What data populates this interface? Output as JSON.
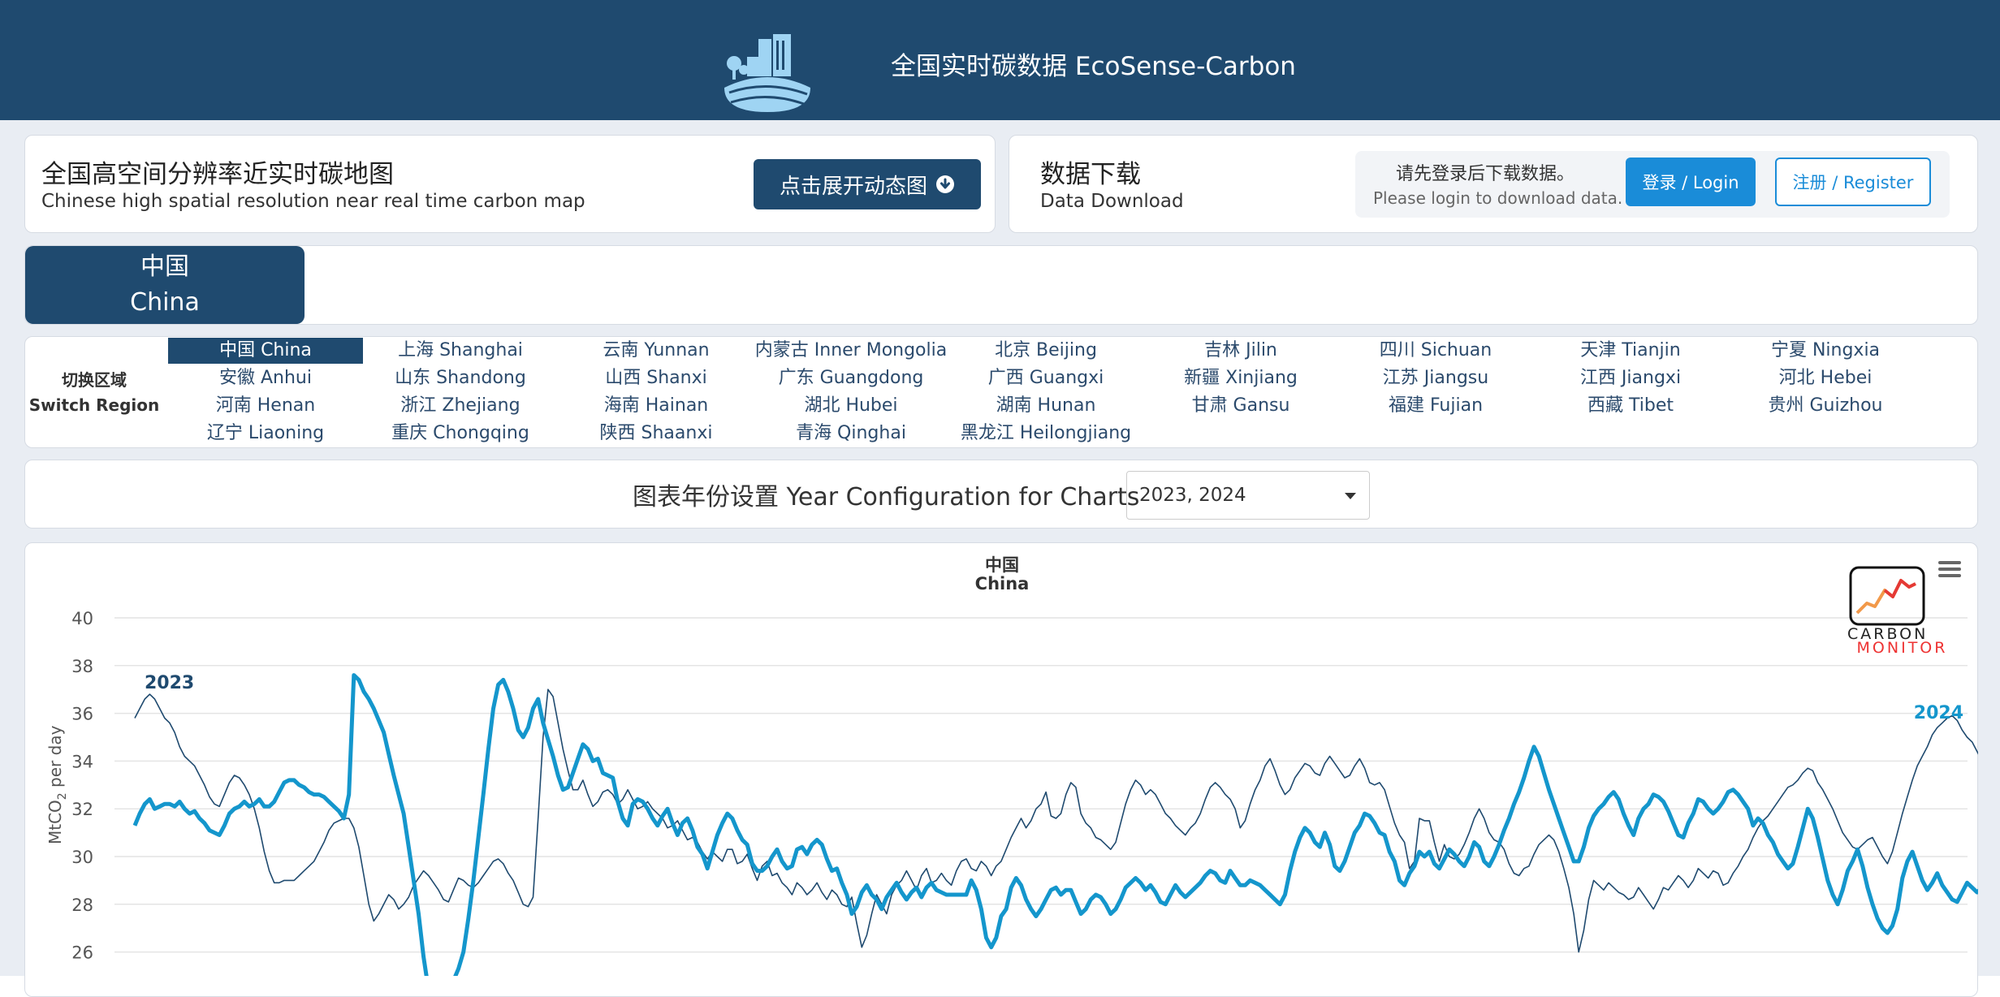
{
  "header": {
    "title": "全国实时碳数据 EcoSense-Carbon"
  },
  "map_card": {
    "title": "全国高空间分辨率近实时碳地图",
    "subtitle": "Chinese high spatial resolution near real time carbon map",
    "expand_button": "点击展开动态图"
  },
  "download_card": {
    "title": "数据下载",
    "subtitle": "Data Download",
    "login_message_cn": "请先登录后下载数据。",
    "login_message_en": "Please login to download data.",
    "login_button": "登录 / Login",
    "register_button": "注册 / Register"
  },
  "country_tab": {
    "cn": "中国",
    "en": "China"
  },
  "region_switcher": {
    "label_cn": "切换区域",
    "label_en": "Switch Region",
    "active": "中国 China",
    "regions": [
      "中国 China",
      "上海 Shanghai",
      "云南 Yunnan",
      "内蒙古 Inner Mongolia",
      "北京 Beijing",
      "吉林 Jilin",
      "四川 Sichuan",
      "天津 Tianjin",
      "宁夏 Ningxia",
      "安徽 Anhui",
      "山东 Shandong",
      "山西 Shanxi",
      "广东 Guangdong",
      "广西 Guangxi",
      "新疆 Xinjiang",
      "江苏 Jiangsu",
      "江西 Jiangxi",
      "河北 Hebei",
      "河南 Henan",
      "浙江 Zhejiang",
      "海南 Hainan",
      "湖北 Hubei",
      "湖南 Hunan",
      "甘肃 Gansu",
      "福建 Fujian",
      "西藏 Tibet",
      "贵州 Guizhou",
      "辽宁 Liaoning",
      "重庆 Chongqing",
      "陕西 Shaanxi",
      "青海 Qinghai",
      "黑龙江 Heilongjiang"
    ]
  },
  "year_config": {
    "label": "图表年份设置 Year Configuration for Charts",
    "selected": "2023, 2024"
  },
  "chart_logo": {
    "line1": "CARBON",
    "line2": "MONITOR"
  },
  "colors": {
    "header_bg": "#1f4a6f",
    "accent": "#1a8cd8",
    "series_2024": "#1496cc",
    "series_2023": "#1f4a6f"
  },
  "chart_data": {
    "type": "line",
    "title": "中国",
    "subtitle": "China",
    "ylabel": "MtCO2 per day",
    "ylim": [
      26,
      40
    ],
    "yticks": [
      26,
      28,
      30,
      32,
      34,
      36,
      38,
      40
    ],
    "grid": true,
    "x": "day of year 1-365",
    "series": [
      {
        "name": "2023",
        "values": [
          35.8,
          36.2,
          36.6,
          36.8,
          36.6,
          36.2,
          35.8,
          35.6,
          35.2,
          34.6,
          34.2,
          34.0,
          33.8,
          33.4,
          33.0,
          32.5,
          32.2,
          32.1,
          32.6,
          33.1,
          33.4,
          33.3,
          33.0,
          32.6,
          32.0,
          31.2,
          30.2,
          29.4,
          28.9,
          28.9,
          29.0,
          29.0,
          29.0,
          29.2,
          29.4,
          29.6,
          29.8,
          30.2,
          30.6,
          31.1,
          31.4,
          31.5,
          31.6,
          31.6,
          31.2,
          30.4,
          29.2,
          28.0,
          27.3,
          27.6,
          28.0,
          28.4,
          28.2,
          27.8,
          28.0,
          28.3,
          28.8,
          29.1,
          29.4,
          29.2,
          28.9,
          28.6,
          28.2,
          28.1,
          28.6,
          29.1,
          29.0,
          28.8,
          28.7,
          28.9,
          29.2,
          29.5,
          29.8,
          29.9,
          29.7,
          29.3,
          29.0,
          28.5,
          28.0,
          27.9,
          28.3,
          31.6,
          35.0,
          37.0,
          36.7,
          35.6,
          34.5,
          33.6,
          32.8,
          32.8,
          33.2,
          32.6,
          32.1,
          32.3,
          32.7,
          32.8,
          32.6,
          32.2,
          32.4,
          32.8,
          32.4,
          32.0,
          32.1,
          32.3,
          32.0,
          31.8,
          31.6,
          31.2,
          31.3,
          31.5,
          31.1,
          30.7,
          30.8,
          30.6,
          30.2,
          29.9,
          30.2,
          30.0,
          29.8,
          30.3,
          30.3,
          29.7,
          29.8,
          30.1,
          29.5,
          29.0,
          29.6,
          29.8,
          29.2,
          29.3,
          28.9,
          28.7,
          28.4,
          28.9,
          28.7,
          28.4,
          28.6,
          28.9,
          28.5,
          28.2,
          28.6,
          28.4,
          28.0,
          27.9,
          28.3,
          27.2,
          26.2,
          26.7,
          27.6,
          28.4,
          28.0,
          27.6,
          28.4,
          28.8,
          29.0,
          29.4,
          29.0,
          28.6,
          29.2,
          29.5,
          28.9,
          29.0,
          29.3,
          29.0,
          28.8,
          29.4,
          29.8,
          29.9,
          29.5,
          29.4,
          29.8,
          29.6,
          29.2,
          29.6,
          29.8,
          30.3,
          30.8,
          31.2,
          31.6,
          31.2,
          31.5,
          32.0,
          32.2,
          32.7,
          31.7,
          31.6,
          31.8,
          32.6,
          33.1,
          32.9,
          31.8,
          31.4,
          31.2,
          30.8,
          30.7,
          30.5,
          30.3,
          30.6,
          31.4,
          32.2,
          32.8,
          33.2,
          33.0,
          32.6,
          32.8,
          32.6,
          32.2,
          31.8,
          31.6,
          31.3,
          31.1,
          30.9,
          31.2,
          31.4,
          31.8,
          32.4,
          32.9,
          33.1,
          32.9,
          32.6,
          32.4,
          32.0,
          31.2,
          31.5,
          32.2,
          32.8,
          33.2,
          33.8,
          34.1,
          33.6,
          33.0,
          32.6,
          32.8,
          33.3,
          33.6,
          33.9,
          33.8,
          33.5,
          33.4,
          33.9,
          34.2,
          33.9,
          33.6,
          33.3,
          33.4,
          33.8,
          34.1,
          33.7,
          33.1,
          33.0,
          33.1,
          32.8,
          32.1,
          31.4,
          30.9,
          30.6,
          29.5,
          29.8,
          31.6,
          31.5,
          31.5,
          30.6,
          29.8,
          30.5,
          30.0,
          29.9,
          30.1,
          30.5,
          31.0,
          31.6,
          32.0,
          31.6,
          31.0,
          30.7,
          30.6,
          30.3,
          29.7,
          29.3,
          29.2,
          29.5,
          29.6,
          30.1,
          30.5,
          30.7,
          30.9,
          30.7,
          30.2,
          29.5,
          28.7,
          27.6,
          26.0,
          26.9,
          28.2,
          29.0,
          28.8,
          28.6,
          28.9,
          28.7,
          28.5,
          28.4,
          28.2,
          28.3,
          28.7,
          28.4,
          28.1,
          27.8,
          28.2,
          28.7,
          28.6,
          28.9,
          29.2,
          29.0,
          28.7,
          29.0,
          29.5,
          29.3,
          29.1,
          29.4,
          29.3,
          28.8,
          28.9,
          29.3,
          29.6,
          30.0,
          30.3,
          30.8,
          31.2,
          31.5,
          31.7,
          32.0,
          32.3,
          32.6,
          32.9,
          33.0,
          33.2,
          33.5,
          33.7,
          33.6,
          33.1,
          32.8,
          32.4,
          32.0,
          31.5,
          31.0,
          30.7,
          30.4,
          30.3,
          30.5,
          30.7,
          30.8,
          30.4,
          30.0,
          29.7,
          30.2,
          31.0,
          31.8,
          32.5,
          33.2,
          33.8,
          34.2,
          34.6,
          35.1,
          35.4,
          35.6,
          35.8,
          35.9,
          35.7,
          35.3,
          35.0,
          34.8,
          34.4,
          34.0,
          33.7,
          33.4
        ]
      },
      {
        "name": "2024",
        "values": [
          31.3,
          31.8,
          32.2,
          32.4,
          32.0,
          32.1,
          32.2,
          32.2,
          32.1,
          32.3,
          32.0,
          31.8,
          31.9,
          31.6,
          31.4,
          31.1,
          31.0,
          30.9,
          31.3,
          31.8,
          32.0,
          32.1,
          32.3,
          32.1,
          32.2,
          32.4,
          32.1,
          32.1,
          32.3,
          32.7,
          33.1,
          33.2,
          33.2,
          33.0,
          32.9,
          32.7,
          32.6,
          32.6,
          32.5,
          32.3,
          32.1,
          31.9,
          31.6,
          32.6,
          37.6,
          37.4,
          36.9,
          36.6,
          36.2,
          35.7,
          35.2,
          34.3,
          33.4,
          32.6,
          31.8,
          30.4,
          29.0,
          27.6,
          25.8,
          24.4,
          23.6,
          23.8,
          24.2,
          24.6,
          24.8,
          25.3,
          26.0,
          27.4,
          29.0,
          30.8,
          32.6,
          34.5,
          36.2,
          37.2,
          37.4,
          36.9,
          36.2,
          35.3,
          35.0,
          35.4,
          36.2,
          36.6,
          35.6,
          34.9,
          34.2,
          33.4,
          32.8,
          32.9,
          33.5,
          34.1,
          34.7,
          34.5,
          34.0,
          34.1,
          33.5,
          33.4,
          33.3,
          32.3,
          31.6,
          31.3,
          32.2,
          32.4,
          32.3,
          32.0,
          31.6,
          31.3,
          31.7,
          32.0,
          31.4,
          30.9,
          31.4,
          31.6,
          31.1,
          30.4,
          30.1,
          29.5,
          30.2,
          30.9,
          31.4,
          31.8,
          31.6,
          31.1,
          30.7,
          30.5,
          29.7,
          29.4,
          29.4,
          29.6,
          30.0,
          30.3,
          29.8,
          29.5,
          29.6,
          30.3,
          30.4,
          30.1,
          30.5,
          30.7,
          30.5,
          29.9,
          29.4,
          29.5,
          28.9,
          28.4,
          27.6,
          27.9,
          28.5,
          28.8,
          28.4,
          28.2,
          27.8,
          28.3,
          28.6,
          28.9,
          28.5,
          28.2,
          28.5,
          28.7,
          28.3,
          28.7,
          28.9,
          28.6,
          28.5,
          28.4,
          28.4,
          28.4,
          28.4,
          28.4,
          29.0,
          28.6,
          27.8,
          26.6,
          26.2,
          26.6,
          27.5,
          27.8,
          28.7,
          29.1,
          28.8,
          28.2,
          27.8,
          27.5,
          27.8,
          28.2,
          28.6,
          28.7,
          28.4,
          28.6,
          28.6,
          28.1,
          27.6,
          27.8,
          28.2,
          28.4,
          28.3,
          28.0,
          27.6,
          27.8,
          28.2,
          28.7,
          28.9,
          29.1,
          28.9,
          28.6,
          28.8,
          28.5,
          28.1,
          28.0,
          28.4,
          28.8,
          28.5,
          28.3,
          28.5,
          28.7,
          28.9,
          29.2,
          29.4,
          29.3,
          29.0,
          28.9,
          29.4,
          29.1,
          28.8,
          28.8,
          29.0,
          28.9,
          28.8,
          28.6,
          28.4,
          28.2,
          28.0,
          28.4,
          29.4,
          30.2,
          30.8,
          31.2,
          31.0,
          30.6,
          30.4,
          31.0,
          30.5,
          29.6,
          29.4,
          29.8,
          30.4,
          31.0,
          31.3,
          31.8,
          31.7,
          31.4,
          31.0,
          30.9,
          30.2,
          29.8,
          29.0,
          28.8,
          29.3,
          29.6,
          30.2,
          30.0,
          30.2,
          29.7,
          29.5,
          29.9,
          30.3,
          30.1,
          29.8,
          29.6,
          30.0,
          30.6,
          30.4,
          29.8,
          29.6,
          30.0,
          30.5,
          31.1,
          31.6,
          32.2,
          32.7,
          33.3,
          34.0,
          34.6,
          34.2,
          33.5,
          32.8,
          32.2,
          31.6,
          31.0,
          30.4,
          29.8,
          29.8,
          30.4,
          31.2,
          31.7,
          32.0,
          32.2,
          32.5,
          32.7,
          32.4,
          31.8,
          31.3,
          30.9,
          31.6,
          32.0,
          32.2,
          32.6,
          32.5,
          32.3,
          31.9,
          31.4,
          30.9,
          30.8,
          31.4,
          31.8,
          32.4,
          32.3,
          32.0,
          31.8,
          32.0,
          32.3,
          32.7,
          32.8,
          32.6,
          32.3,
          32.0,
          31.3,
          31.6,
          31.4,
          30.9,
          30.6,
          30.1,
          29.8,
          29.5,
          29.7,
          30.4,
          31.2,
          32.0,
          31.6,
          30.8,
          29.9,
          29.0,
          28.4,
          28.0,
          28.6,
          29.4,
          29.8,
          30.3,
          29.6,
          28.7,
          28.0,
          27.4,
          27.0,
          26.8,
          27.1,
          27.8,
          29.1,
          29.8,
          30.2,
          29.6,
          29.0,
          28.6,
          28.9,
          29.3,
          28.8,
          28.5,
          28.2,
          28.1,
          28.5,
          28.9,
          28.7,
          28.5,
          28.7,
          29.0,
          28.6,
          28.9,
          29.2
        ]
      }
    ]
  }
}
